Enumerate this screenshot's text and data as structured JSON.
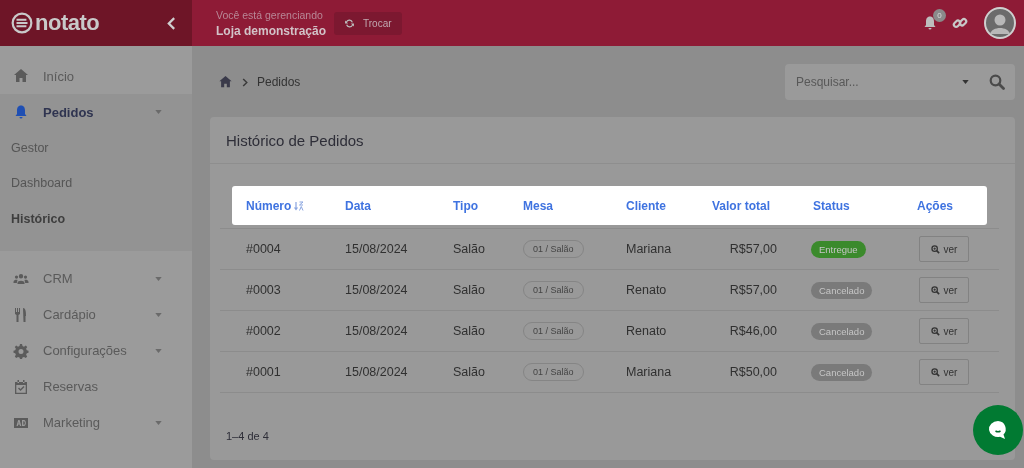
{
  "header": {
    "logo": "notato",
    "managing_label": "Você está gerenciando",
    "store": "Loja demonstração",
    "switch_button": "Trocar",
    "notifications": "0"
  },
  "sidebar": {
    "items": [
      {
        "label": "Início",
        "has_caret": false,
        "active": false
      },
      {
        "label": "Pedidos",
        "has_caret": true,
        "active": true,
        "children": [
          {
            "label": "Gestor",
            "selected": false
          },
          {
            "label": "Dashboard",
            "selected": false
          },
          {
            "label": "Histórico",
            "selected": true
          }
        ]
      },
      {
        "label": "CRM",
        "has_caret": true,
        "active": false
      },
      {
        "label": "Cardápio",
        "has_caret": true,
        "active": false
      },
      {
        "label": "Configurações",
        "has_caret": true,
        "active": false
      },
      {
        "label": "Reservas",
        "has_caret": false,
        "active": false
      },
      {
        "label": "Marketing",
        "has_caret": true,
        "active": false
      }
    ]
  },
  "breadcrumb": [
    "Pedidos"
  ],
  "search": {
    "placeholder": "Pesquisar..."
  },
  "card": {
    "title": "Histórico de Pedidos"
  },
  "table": {
    "columns": [
      "Número",
      "Data",
      "Tipo",
      "Mesa",
      "Cliente",
      "Valor total",
      "Status",
      "Ações"
    ],
    "rows": [
      {
        "number": "#0004",
        "date": "15/08/2024",
        "type": "Salão",
        "table": "01 / Salão",
        "client": "Mariana",
        "total": "R$57,00",
        "status": {
          "label": "Entregue",
          "color": "#3b8a2c"
        },
        "action": "ver"
      },
      {
        "number": "#0003",
        "date": "15/08/2024",
        "type": "Salão",
        "table": "01 / Salão",
        "client": "Renato",
        "total": "R$57,00",
        "status": {
          "label": "Cancelado",
          "color": "#7a7a7a"
        },
        "action": "ver"
      },
      {
        "number": "#0002",
        "date": "15/08/2024",
        "type": "Salão",
        "table": "01 / Salão",
        "client": "Renato",
        "total": "R$46,00",
        "status": {
          "label": "Cancelado",
          "color": "#7a7a7a"
        },
        "action": "ver"
      },
      {
        "number": "#0001",
        "date": "15/08/2024",
        "type": "Salão",
        "table": "01 / Salão",
        "client": "Mariana",
        "total": "R$50,00",
        "status": {
          "label": "Cancelado",
          "color": "#7a7a7a"
        },
        "action": "ver"
      }
    ]
  },
  "pagination": "1–4 de 4"
}
